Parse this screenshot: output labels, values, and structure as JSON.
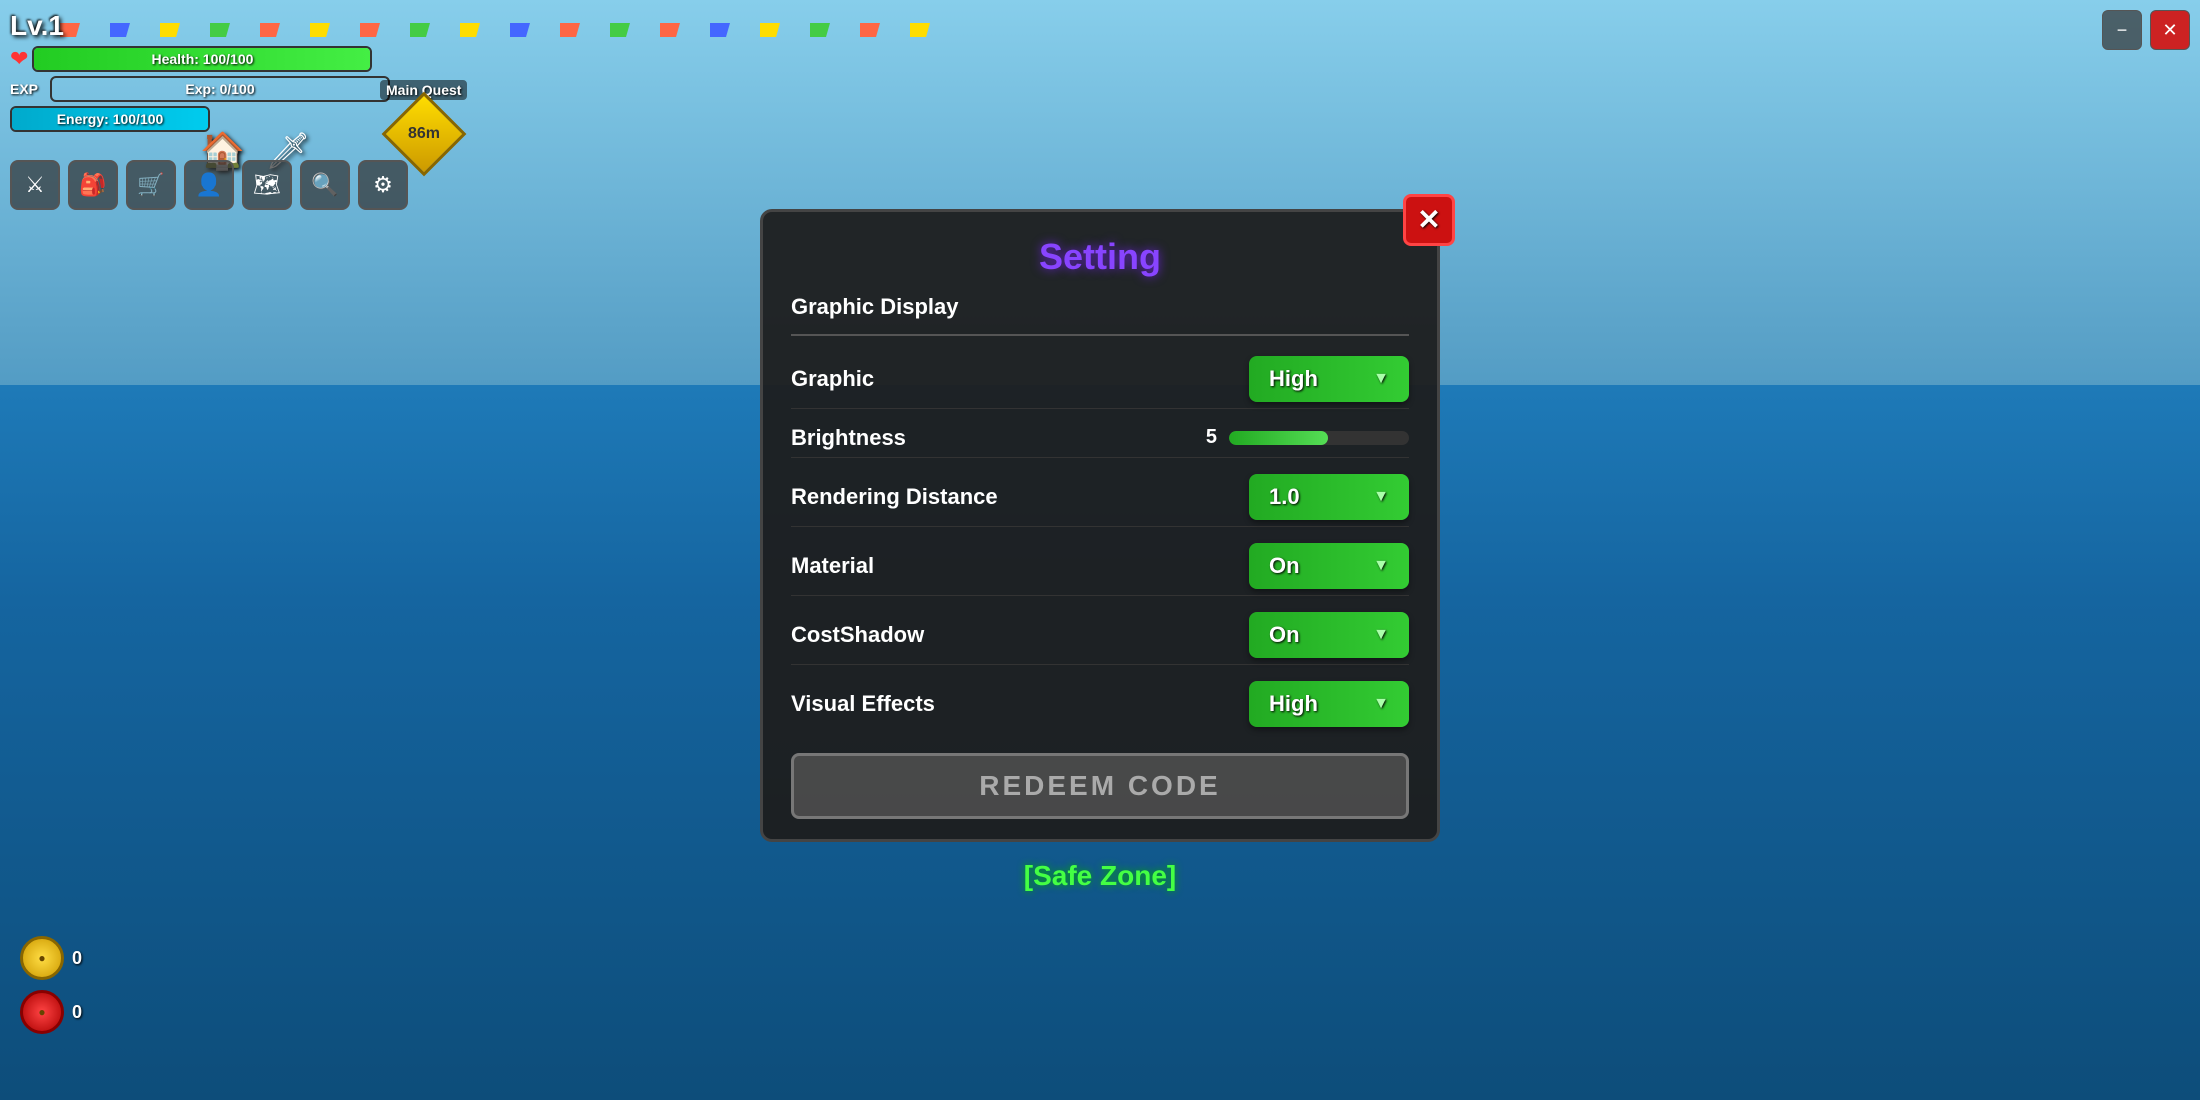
{
  "game": {
    "title": "Setting",
    "level": "Lv.1",
    "health": {
      "label": "Health: 100/100",
      "current": 100,
      "max": 100,
      "percent": 100
    },
    "exp": {
      "label": "EXP",
      "value_label": "Exp: 0/100",
      "current": 0,
      "max": 100,
      "percent": 0
    },
    "energy": {
      "label": "Energy: 100/100",
      "current": 100,
      "max": 100,
      "percent": 100
    },
    "main_quest": {
      "label": "Main Quest",
      "distance": "86m"
    },
    "safe_zone": "[Safe Zone]",
    "coins": [
      {
        "value": "0",
        "color": "gold"
      },
      {
        "value": "0",
        "color": "red"
      }
    ]
  },
  "settings_modal": {
    "title": "Setting",
    "close_label": "✕",
    "section_title": "Graphic Display",
    "rows": [
      {
        "label": "Graphic",
        "value": "High",
        "type": "dropdown"
      },
      {
        "label": "Brightness",
        "value": "5",
        "type": "slider",
        "slider_percent": 55
      },
      {
        "label": "Rendering Distance",
        "value": "1.0",
        "type": "dropdown"
      },
      {
        "label": "Material",
        "value": "On",
        "type": "dropdown"
      },
      {
        "label": "CostShadow",
        "value": "On",
        "type": "dropdown"
      },
      {
        "label": "Visual Effects",
        "value": "High",
        "type": "dropdown"
      }
    ],
    "redeem_code_label": "REDEEM CODE"
  },
  "nav_icons": {
    "items": [
      "⚔",
      "🎒",
      "🛒",
      "👤",
      "🗺",
      "🔍",
      "⚙"
    ],
    "top_items": [
      "🏠",
      "⚔"
    ]
  },
  "banner_flags": [
    1,
    2,
    3,
    4,
    5,
    6,
    7,
    8,
    9,
    10,
    11,
    12,
    13,
    14,
    15,
    16,
    17,
    18
  ]
}
